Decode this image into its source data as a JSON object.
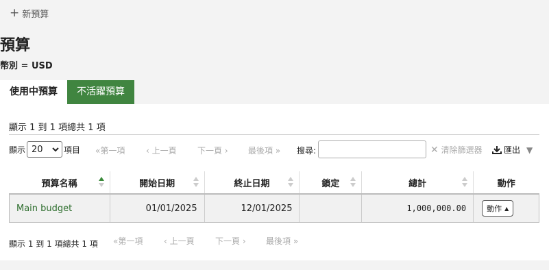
{
  "toolbar": {
    "new_budget_label": "新預算"
  },
  "page": {
    "title": "預算",
    "currency": "幣別 = USD"
  },
  "tabs": [
    {
      "label": "使用中預算",
      "active": true
    },
    {
      "label": "不活躍預算",
      "active": false
    }
  ],
  "table_info": {
    "top": "顯示 1 到 1 項總共 1 項",
    "bottom": "顯示 1 到 1 項總共 1 項"
  },
  "length_menu": {
    "prefix": "顯示",
    "value": "20",
    "suffix": "項目"
  },
  "pager": {
    "first": "第一項",
    "prev": "上一頁",
    "next": "下一頁",
    "last": "最後項"
  },
  "search": {
    "label": "搜尋:",
    "value": ""
  },
  "clear_filter": "清除篩選器",
  "export": "匯出",
  "columns": [
    "預算名稱",
    "開始日期",
    "終止日期",
    "鎖定",
    "總計",
    "動作"
  ],
  "rows": [
    {
      "name": "Main budget",
      "start": "01/01/2025",
      "end": "12/01/2025",
      "locked": "",
      "total": "1,000,000.00",
      "action": "動作"
    }
  ],
  "colors": {
    "accent": "#408540",
    "link": "#2e6e2e"
  }
}
